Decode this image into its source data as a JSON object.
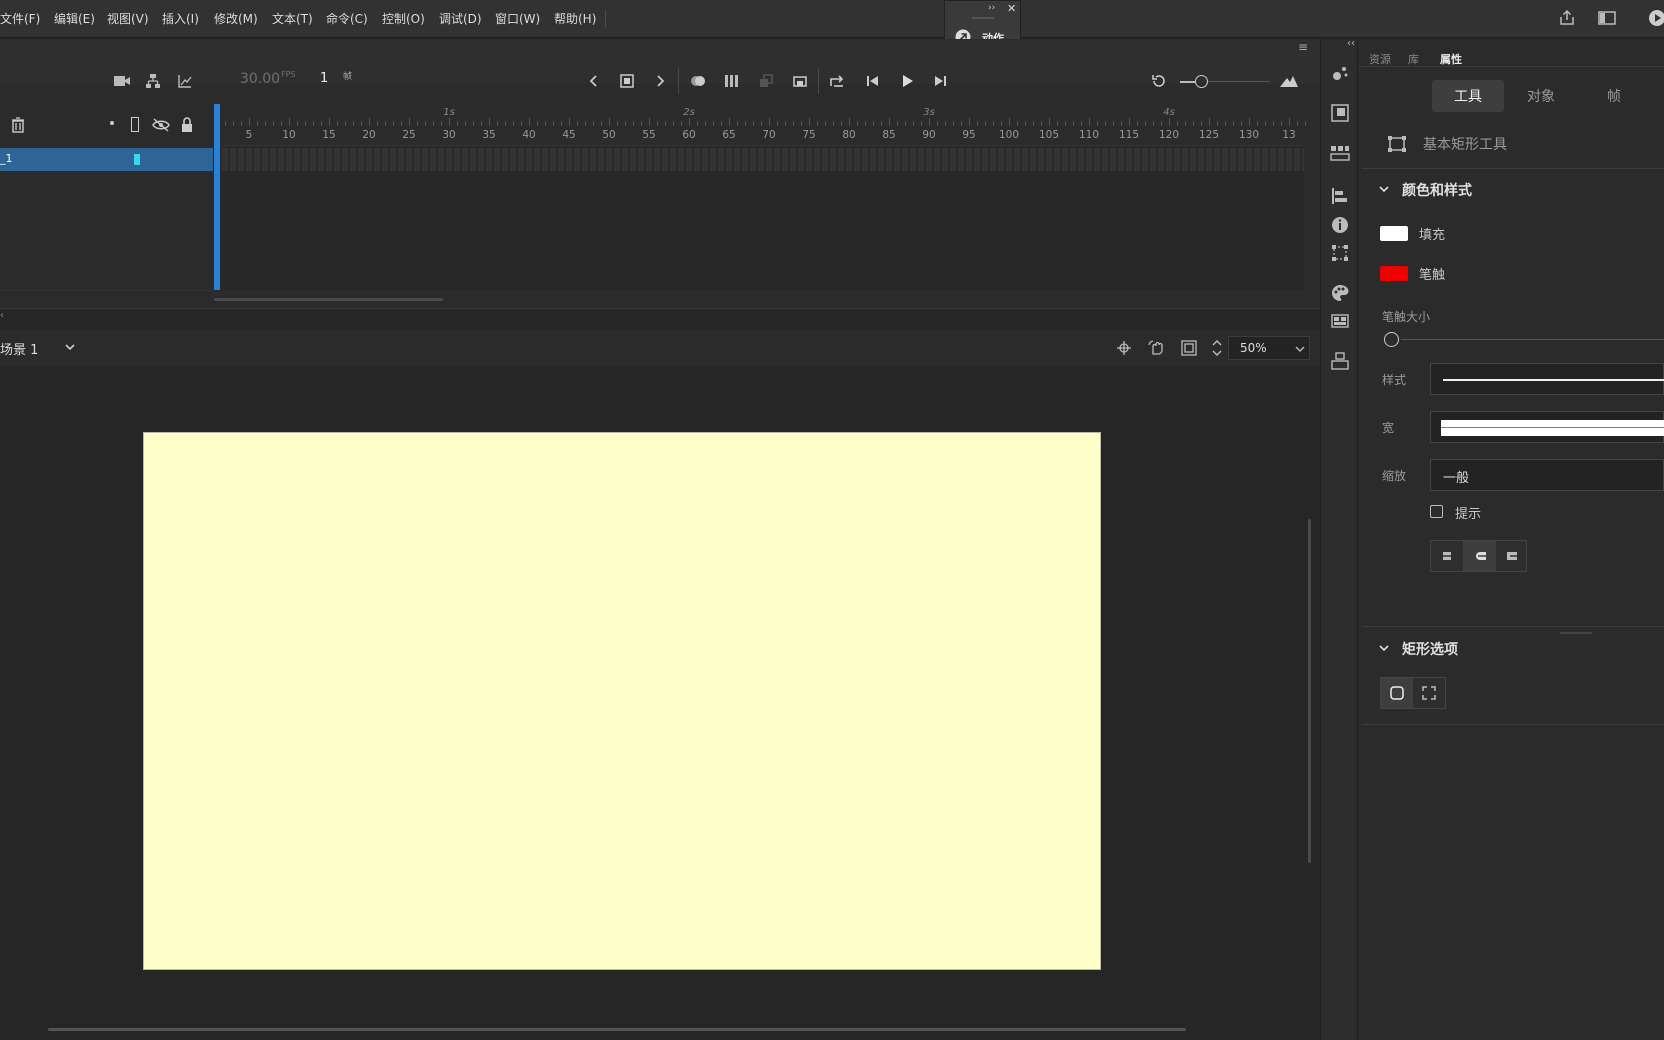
{
  "menu": [
    "文件(F)",
    "编辑(E)",
    "视图(V)",
    "插入(I)",
    "修改(M)",
    "文本(T)",
    "命令(C)",
    "控制(O)",
    "调试(D)",
    "窗口(W)",
    "帮助(H)"
  ],
  "float_panel": {
    "title": "动作"
  },
  "timeline": {
    "fps": "30.00",
    "fps_unit": "FPS",
    "frame_number": "1",
    "frame_unit": "帧",
    "layer_name": "_1",
    "seconds": [
      "1s",
      "2s",
      "3s",
      "4s"
    ],
    "ticks": [
      "5",
      "10",
      "15",
      "20",
      "25",
      "30",
      "35",
      "40",
      "45",
      "50",
      "55",
      "60",
      "65",
      "70",
      "75",
      "80",
      "85",
      "90",
      "95",
      "100",
      "105",
      "110",
      "115",
      "120",
      "125",
      "130",
      "13"
    ]
  },
  "scene": {
    "name": "场景 1",
    "zoom": "50%"
  },
  "stage": {
    "color": "#feffc9"
  },
  "panel_tabs": [
    "资源",
    "库",
    "属性"
  ],
  "properties": {
    "segments": [
      "工具",
      "对象",
      "帧"
    ],
    "active_segment": "工具",
    "tool_name": "基本矩形工具",
    "color_style": {
      "title": "颜色和样式",
      "fill_label": "填充",
      "fill_color": "#ffffff",
      "stroke_label": "笔触",
      "stroke_color": "#ee0000",
      "stroke_size_label": "笔触大小",
      "style_label": "样式",
      "width_label": "宽",
      "scale_label": "缩放",
      "scale_value": "一般",
      "hint_label": "提示"
    },
    "rect_options": {
      "title": "矩形选项"
    }
  }
}
